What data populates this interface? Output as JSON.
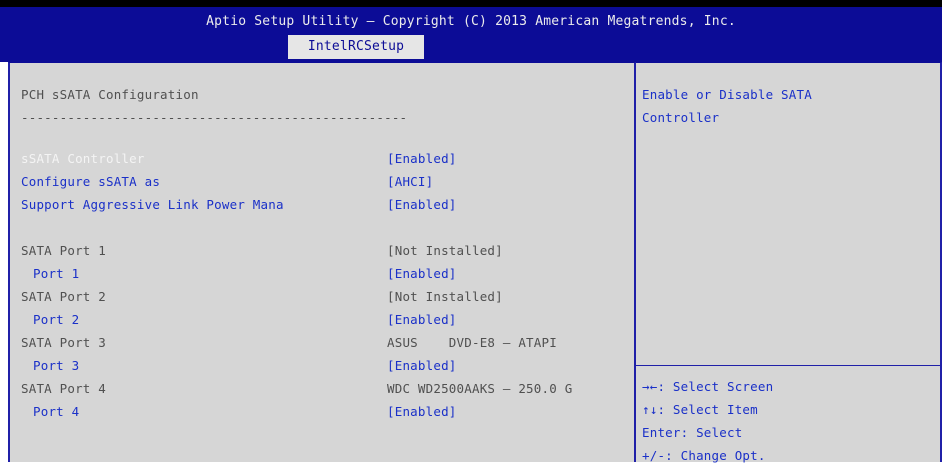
{
  "header": {
    "title": "Aptio Setup Utility – Copyright (C) 2013 American Megatrends, Inc.",
    "active_tab": "IntelRCSetup"
  },
  "main": {
    "page_title": "PCH sSATA Configuration",
    "separator": "--------------------------------------------------",
    "settings": [
      {
        "label": "sSATA Controller",
        "value": "[Enabled]"
      },
      {
        "label": "Configure sSATA as",
        "value": "[AHCI]"
      },
      {
        "label": "Support Aggressive Link Power Mana",
        "value": "[Enabled]"
      }
    ],
    "ports": [
      {
        "name": "SATA Port 1",
        "device": "[Not Installed]",
        "sub_label": "Port 1",
        "sub_value": "[Enabled]"
      },
      {
        "name": "SATA Port 2",
        "device": "[Not Installed]",
        "sub_label": "Port 2",
        "sub_value": "[Enabled]"
      },
      {
        "name": "SATA Port 3",
        "device": "ASUS    DVD-E8 – ATAPI",
        "sub_label": "Port 3",
        "sub_value": "[Enabled]"
      },
      {
        "name": "SATA Port 4",
        "device": "WDC WD2500AAKS – 250.0 G",
        "sub_label": "Port 4",
        "sub_value": "[Enabled]"
      }
    ]
  },
  "help": {
    "line1": "Enable or Disable SATA",
    "line2": "Controller"
  },
  "keys": [
    "→←: Select Screen",
    "↑↓: Select Item",
    "Enter: Select",
    "+/-: Change Opt."
  ],
  "colors": {
    "header_bg": "#0c0c96",
    "panel_bg": "#d6d6d6",
    "selectable_text": "#1a30c8",
    "info_text": "#505050",
    "highlight_text": "#f4f4f4"
  }
}
